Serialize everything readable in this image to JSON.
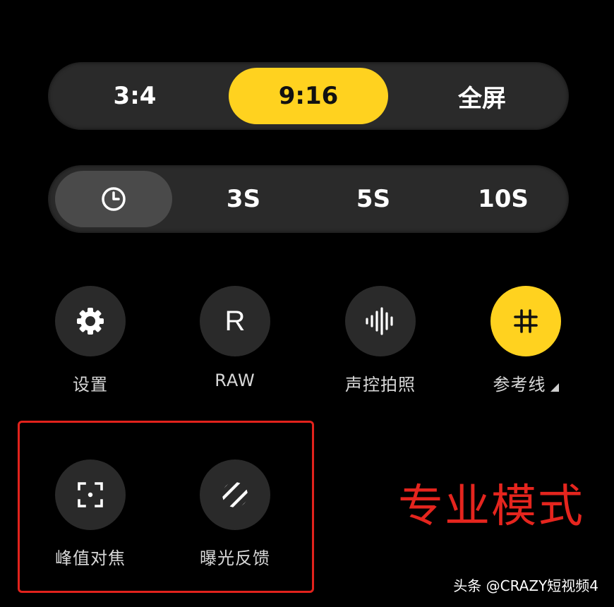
{
  "aspect_ratio": {
    "options": [
      "3:4",
      "9:16",
      "全屏"
    ],
    "selected": "9:16"
  },
  "timer": {
    "icon": "timer-icon",
    "options": [
      "3S",
      "5S",
      "10S"
    ]
  },
  "tools": [
    {
      "label": "设置",
      "icon": "gear-icon"
    },
    {
      "label": "RAW",
      "icon": "raw-letter-icon",
      "glyph": "R"
    },
    {
      "label": "声控拍照",
      "icon": "sound-wave-icon"
    },
    {
      "label": "参考线",
      "icon": "grid-icon",
      "active": true
    }
  ],
  "pro_tools": [
    {
      "label": "峰值对焦",
      "icon": "focus-peaking-icon"
    },
    {
      "label": "曝光反馈",
      "icon": "exposure-feedback-icon"
    }
  ],
  "annotation": {
    "text": "专业模式"
  },
  "watermark": "头条 @CRAZY短视频4",
  "colors": {
    "accent": "#ffd21f",
    "panel": "#2a2a2a",
    "highlight_red": "#e2221c"
  }
}
